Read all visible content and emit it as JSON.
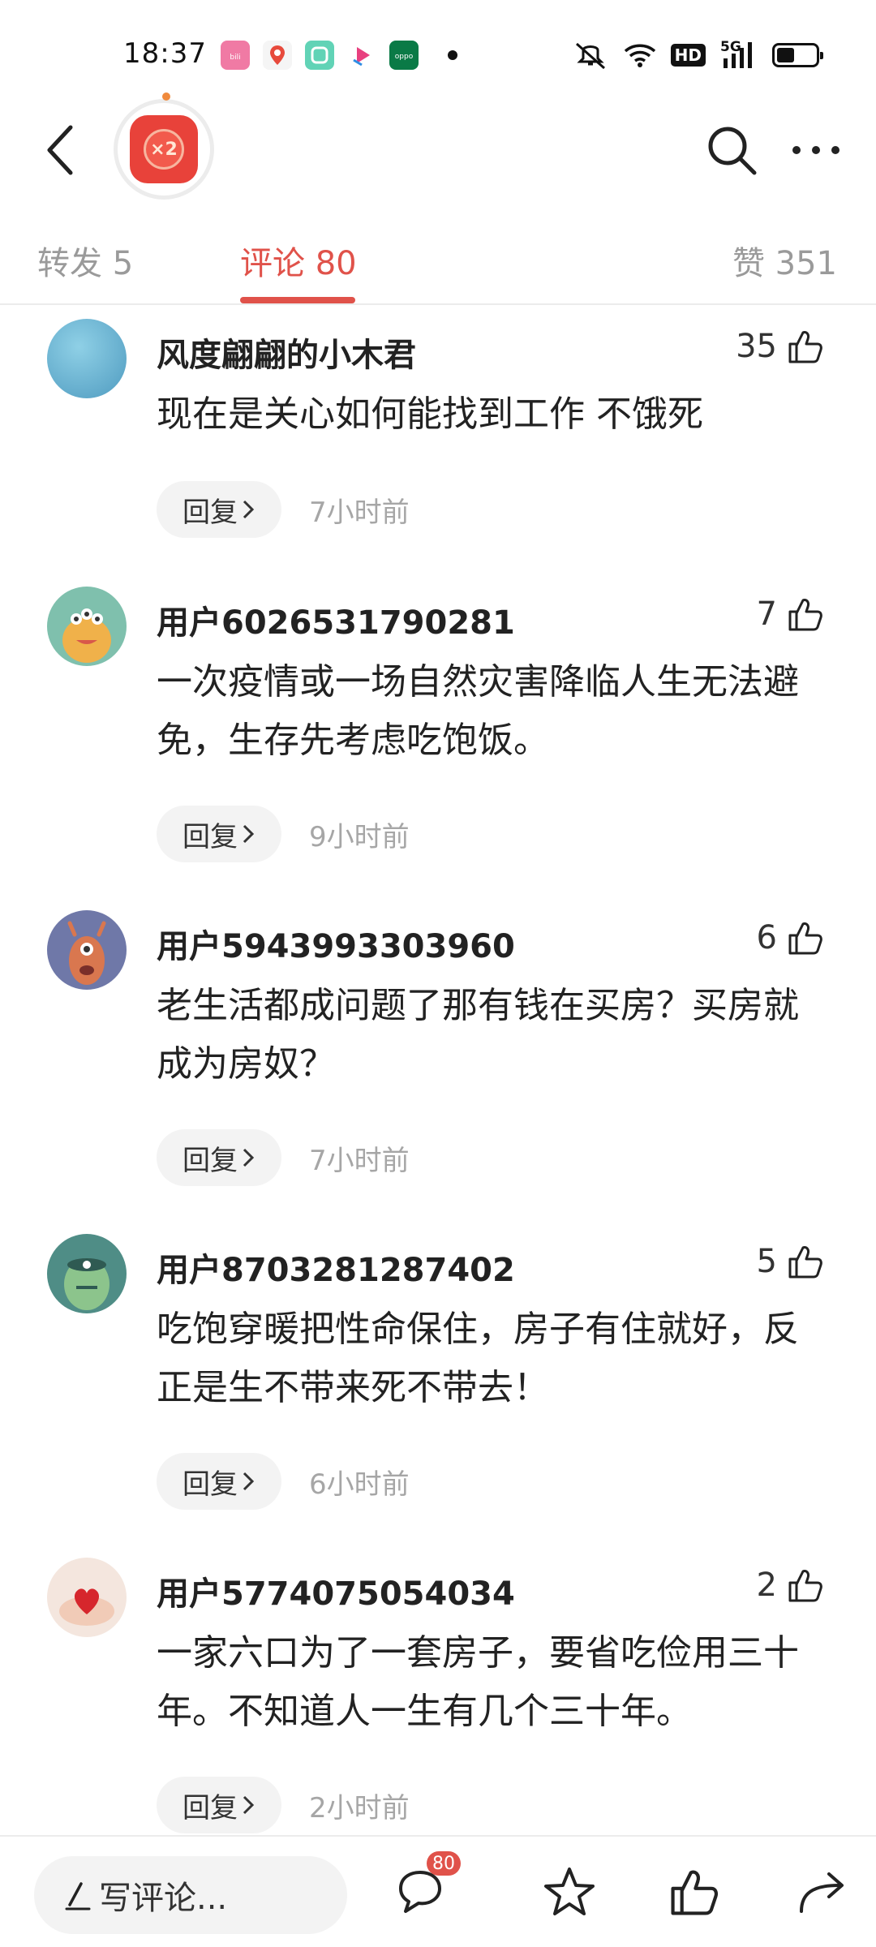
{
  "status_bar": {
    "time": "18:37",
    "network": "5G",
    "hd_label": "HD",
    "battery_level": 0.45,
    "app_icons": [
      {
        "name": "bilibili-icon",
        "color": "#f07aa4"
      },
      {
        "name": "map-pin-icon",
        "color": "#f3f3f3"
      },
      {
        "name": "green-app-icon",
        "color": "#61d3b6"
      },
      {
        "name": "video-app-icon",
        "color": "#ffffff"
      },
      {
        "name": "oppo-icon",
        "color": "#0a7a46"
      }
    ]
  },
  "nav": {
    "badge_text": "×2"
  },
  "tabs": [
    {
      "label": "转发 5"
    },
    {
      "label": "评论 80"
    },
    {
      "label": "赞 351"
    }
  ],
  "comments": [
    {
      "name": "风度翩翩的小木君",
      "likes": "35",
      "text": "现在是关心如何能找到工作 不饿死",
      "reply": "回复",
      "time": "7小时前",
      "avatar_color": "#5aa9c9"
    },
    {
      "name": "用户6026531790281",
      "likes": "7",
      "text": "一次疫情或一场自然灾害降临人生无法避免，生存先考虑吃饱饭。",
      "reply": "回复",
      "time": "9小时前",
      "avatar_color": "#6fb8a6"
    },
    {
      "name": "用户5943993303960",
      "likes": "6",
      "text": "老生活都成问题了那有钱在买房？买房就成为房奴？",
      "reply": "回复",
      "time": "7小时前",
      "avatar_color": "#6f78a8"
    },
    {
      "name": "用户8703281287402",
      "likes": "5",
      "text": "吃饱穿暖把性命保住，房子有住就好，反正是生不带来死不带去！",
      "reply": "回复",
      "time": "6小时前",
      "avatar_color": "#4f8d86"
    },
    {
      "name": "用户5774075054034",
      "likes": "2",
      "text": "一家六口为了一套房子，要省吃俭用三十年。不知道人一生有几个三十年。",
      "reply": "回复",
      "time": "2小时前",
      "avatar_color": "#f2e2da"
    }
  ],
  "bottom_bar": {
    "write_placeholder": "写评论...",
    "comment_count": "80"
  },
  "colors": {
    "accent": "#e0524a",
    "muted": "#9a9a9a"
  }
}
